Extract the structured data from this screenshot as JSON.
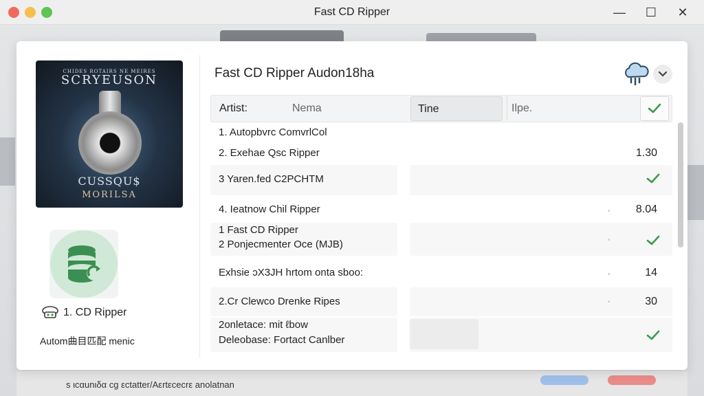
{
  "window": {
    "title": "Fast CD Ripper",
    "minimize": "—",
    "maximize": "☐",
    "close": "✕"
  },
  "album": {
    "top_line": "CHIDES ROTAIRS NE MEIRES",
    "title": "SCRYEUSON",
    "bottom1": "CUSSQU$",
    "bottom2": "MORILSA"
  },
  "sidebar": {
    "app_label": "1. CD Ripper",
    "sub_label": "Autom曲目匹配 menic"
  },
  "panel": {
    "title": "Fast CD Ripper Audon18ha"
  },
  "table": {
    "headers": {
      "artist": "Artist:",
      "name": "Nema",
      "time": "Tine",
      "type": "Ilpe."
    },
    "rows": [
      {
        "lines": [
          "1. Autopbvrc ComvrlCol"
        ],
        "value": "",
        "check": false,
        "shade": false
      },
      {
        "lines": [
          "2. Exehae Qsc Ripper"
        ],
        "value": "1.30",
        "check": false,
        "shade": false
      },
      {
        "lines": [
          "3 Yaren.fed C2PCHTM"
        ],
        "value": "",
        "check": true,
        "shade": true
      },
      {
        "lines": [
          "4. Ieatnow Chil Ripper"
        ],
        "value": "8.04",
        "check": false,
        "shade": false
      },
      {
        "lines": [
          "1 Fast CD Ripper",
          "2 Ponjecmenter Oce (MJB)"
        ],
        "value": "",
        "check": true,
        "shade": true
      },
      {
        "lines": [
          "Exhsie ɔX3JH hrtom onta sboo:"
        ],
        "value": "14",
        "check": false,
        "shade": false
      },
      {
        "lines": [
          "2.Cr Clewco Drenke Ripes"
        ],
        "value": "30",
        "check": false,
        "shade": true
      },
      {
        "lines": [
          "2onletace: mit ℓbow",
          "Deleobase: Fortact Canlber"
        ],
        "value": "",
        "check": true,
        "shade": true
      }
    ]
  },
  "footer": {
    "text": "s ιcαunιδα cg εctatter/Aεrtεcecrε anolatnan"
  },
  "colors": {
    "accent_green": "#3a9a4b",
    "database_green": "#3c8f52"
  },
  "icons": [
    "cloud-sync-icon",
    "chevron-down-icon",
    "check-icon",
    "database-sync-icon",
    "app-badge-icon"
  ]
}
